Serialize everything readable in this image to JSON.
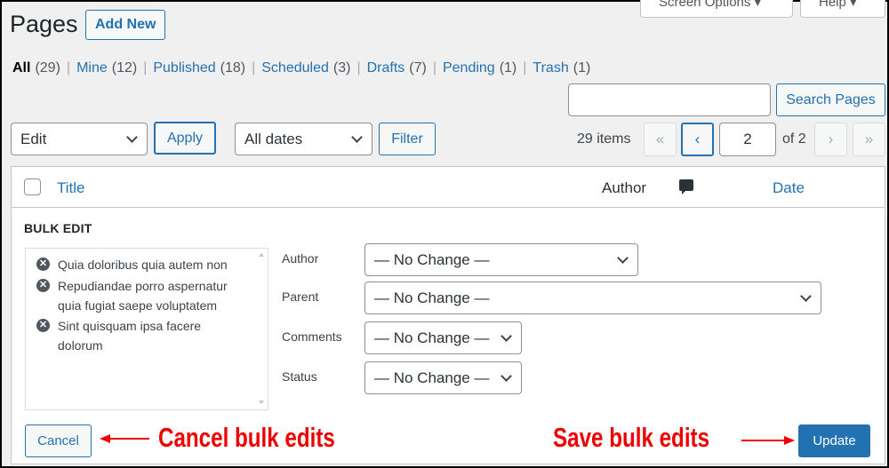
{
  "screen_tabs": {
    "screen_options": "Screen Options ▾",
    "help": "Help ▾"
  },
  "header": {
    "title": "Pages",
    "add_new": "Add New"
  },
  "status_filters": [
    {
      "label": "All",
      "count": "(29)",
      "current": true
    },
    {
      "label": "Mine",
      "count": "(12)"
    },
    {
      "label": "Published",
      "count": "(18)"
    },
    {
      "label": "Scheduled",
      "count": "(3)"
    },
    {
      "label": "Drafts",
      "count": "(7)"
    },
    {
      "label": "Pending",
      "count": "(1)"
    },
    {
      "label": "Trash",
      "count": "(1)"
    }
  ],
  "search": {
    "value": "",
    "button": "Search Pages"
  },
  "toolbar": {
    "bulk_action": "Edit",
    "apply": "Apply",
    "date_filter": "All dates",
    "filter": "Filter"
  },
  "pagination": {
    "items": "29 items",
    "first": "«",
    "prev": "‹",
    "current_page": "2",
    "of_total": "of 2",
    "next": "›",
    "last": "»"
  },
  "table": {
    "columns": {
      "title": "Title",
      "author": "Author",
      "comments_icon": "comment-icon",
      "date": "Date"
    }
  },
  "bulk_edit": {
    "heading": "BULK EDIT",
    "selected_titles": [
      "Quia doloribus quia autem non",
      "Repudiandae porro aspernatur quia fugiat saepe voluptatem",
      "Sint quisquam ipsa facere dolorum"
    ],
    "fields": {
      "author": {
        "label": "Author",
        "value": "— No Change —"
      },
      "parent": {
        "label": "Parent",
        "value": "— No Change —"
      },
      "comments": {
        "label": "Comments",
        "value": "— No Change —"
      },
      "status": {
        "label": "Status",
        "value": "— No Change —"
      }
    },
    "cancel": "Cancel",
    "update": "Update"
  },
  "annotations": {
    "cancel": "Cancel bulk edits",
    "save": "Save bulk edits"
  },
  "colors": {
    "accent": "#2271b1",
    "annotation": "#ee0000",
    "background": "#f0f0f1"
  }
}
